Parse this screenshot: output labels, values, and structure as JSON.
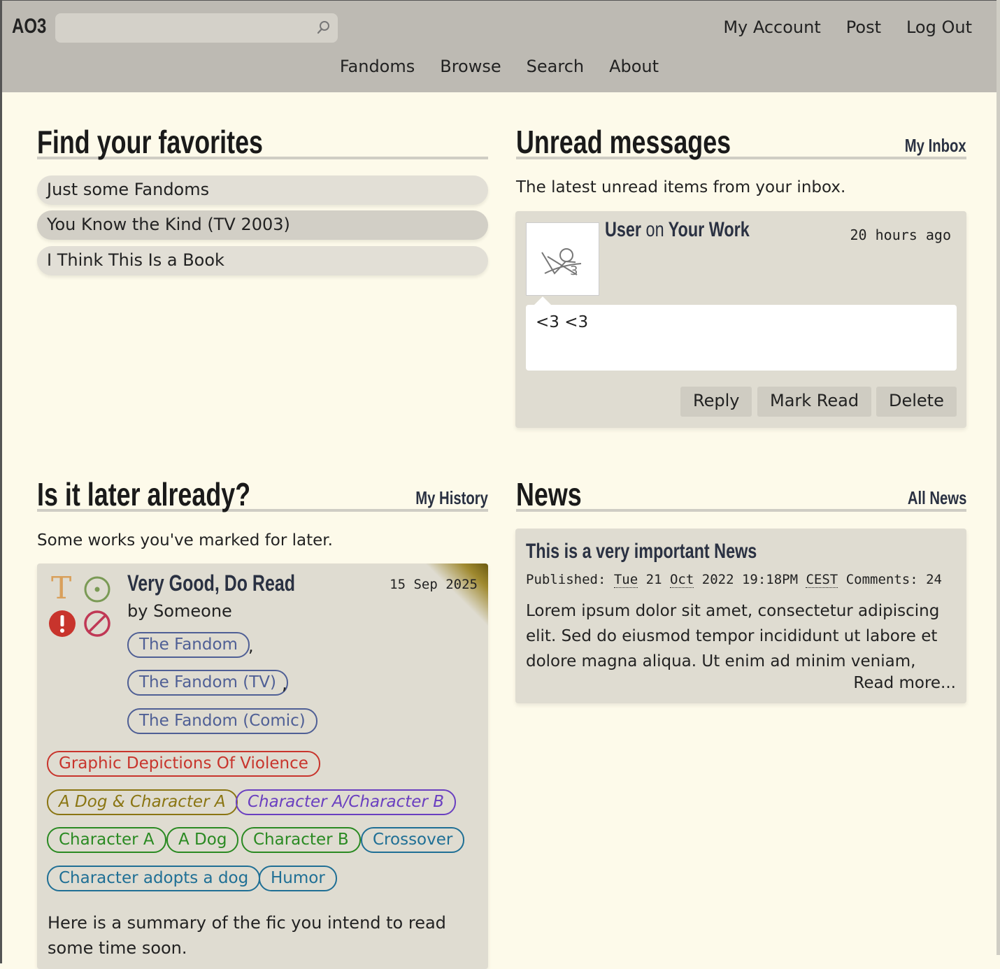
{
  "header": {
    "logo": "AO3",
    "search": {
      "placeholder": ""
    },
    "top_nav": [
      "My Account",
      "Post",
      "Log Out"
    ],
    "main_nav": [
      "Fandoms",
      "Browse",
      "Search",
      "About"
    ]
  },
  "favorites": {
    "title": "Find your favorites",
    "items": [
      "Just some Fandoms",
      "You Know the Kind (TV 2003)",
      "I Think This Is a Book"
    ]
  },
  "messages": {
    "title": "Unread messages",
    "link": "My Inbox",
    "intro": "The latest unread items from your inbox.",
    "item": {
      "title_user": "User",
      "title_on": "on",
      "title_work": "Your Work",
      "time": "20 hours ago",
      "body": "<3 <3",
      "buttons": [
        "Reply",
        "Mark Read",
        "Delete"
      ]
    }
  },
  "later": {
    "title": "Is it later already?",
    "link": "My History",
    "intro": "Some works you've marked for later.",
    "work": {
      "title": "Very Good, Do Read",
      "date": "15 Sep 2025",
      "author": "by Someone",
      "rating_symbol": "T",
      "fandoms": [
        "The Fandom",
        "The Fandom (TV)",
        "The Fandom (Comic)"
      ],
      "warnings": [
        "Graphic Depictions Of Violence"
      ],
      "relationships": [
        "A Dog & Character A",
        "Character A/Character B"
      ],
      "characters": [
        "Character A",
        "A Dog",
        "Character B"
      ],
      "freeforms": [
        "Crossover",
        "Character adopts a dog",
        "Humor"
      ],
      "summary": "Here is a summary of the fic you intend to read some time soon."
    }
  },
  "news": {
    "title": "News",
    "link": "All News",
    "item": {
      "title": "This is a very important News",
      "published_label": "Published:",
      "published_day": "Tue",
      "published_date": "21",
      "published_month": "Oct",
      "published_year_time": "2022 19:18PM",
      "published_tz": "CEST",
      "comments_label": "Comments:",
      "comments": "24",
      "text": "Lorem ipsum dolor sit amet, consectetur adipiscing elit. Sed do eiusmod tempor incididunt ut labore et dolore magna aliqua. Ut enim ad minim veniam,",
      "read_more": "Read more..."
    }
  },
  "colors": {
    "background": "#fdfaea",
    "header": "#bdbab3",
    "panel": "#dfdcd1",
    "link": "#2a3142"
  }
}
